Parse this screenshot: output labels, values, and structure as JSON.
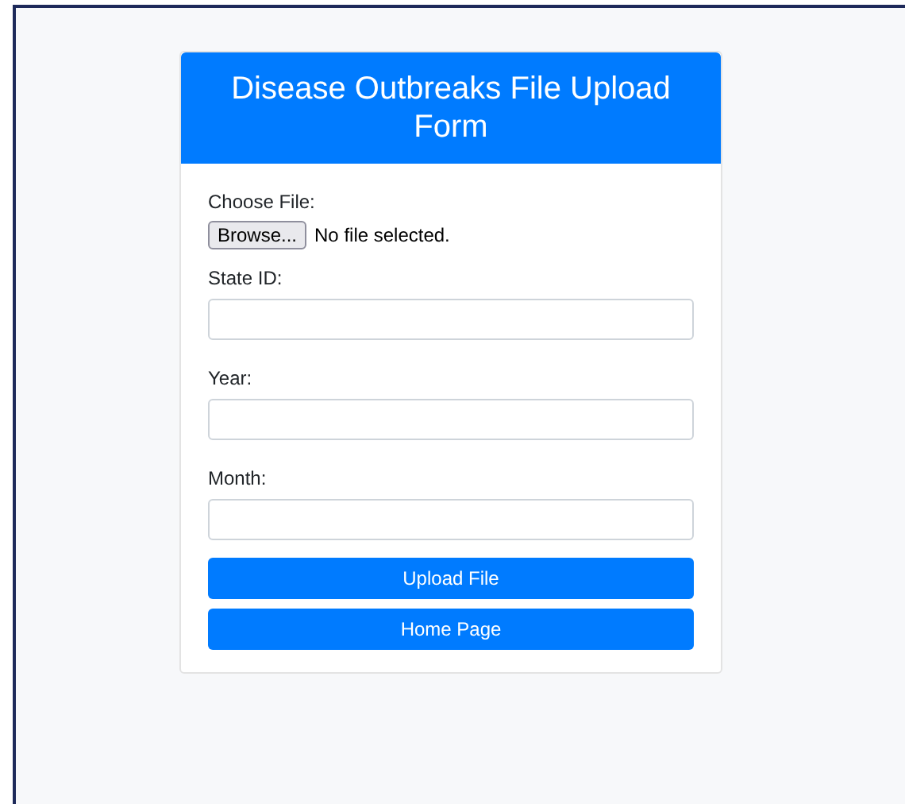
{
  "form": {
    "title": "Disease Outbreaks File Upload Form",
    "file_input": {
      "label": "Choose File:",
      "button": "Browse...",
      "status": "No file selected."
    },
    "fields": [
      {
        "label": "State ID:"
      },
      {
        "label": "Year:"
      },
      {
        "label": "Month:"
      }
    ],
    "buttons": [
      "Upload File",
      "Home Page"
    ]
  }
}
